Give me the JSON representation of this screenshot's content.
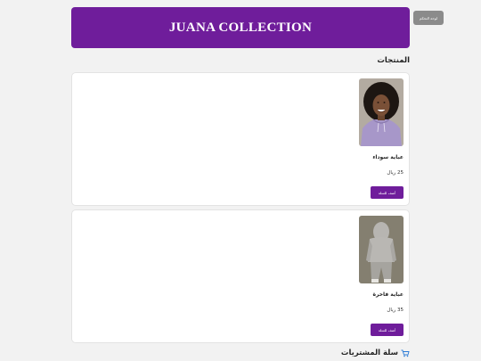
{
  "admin_button": {
    "label": "لوحة التحكم"
  },
  "header": {
    "title": "JUANA COLLECTION"
  },
  "products_section": {
    "title": "المنتجات"
  },
  "products": [
    {
      "name": "عباية سوداء",
      "price": "25 ريال",
      "add_label": "أضف للسلة",
      "image_icon": "woman-purple-hoodie-photo"
    },
    {
      "name": "عباية فاخرة",
      "price": "35 ريال",
      "add_label": "أضف للسلة",
      "image_icon": "gray-hoodie-back-photo"
    }
  ],
  "cart": {
    "title": "سلة المشتريات",
    "icon": "cart-icon"
  },
  "colors": {
    "accent": "#6f1d9b",
    "admin_button": "#8b8b8b",
    "background": "#f2f2f2"
  }
}
